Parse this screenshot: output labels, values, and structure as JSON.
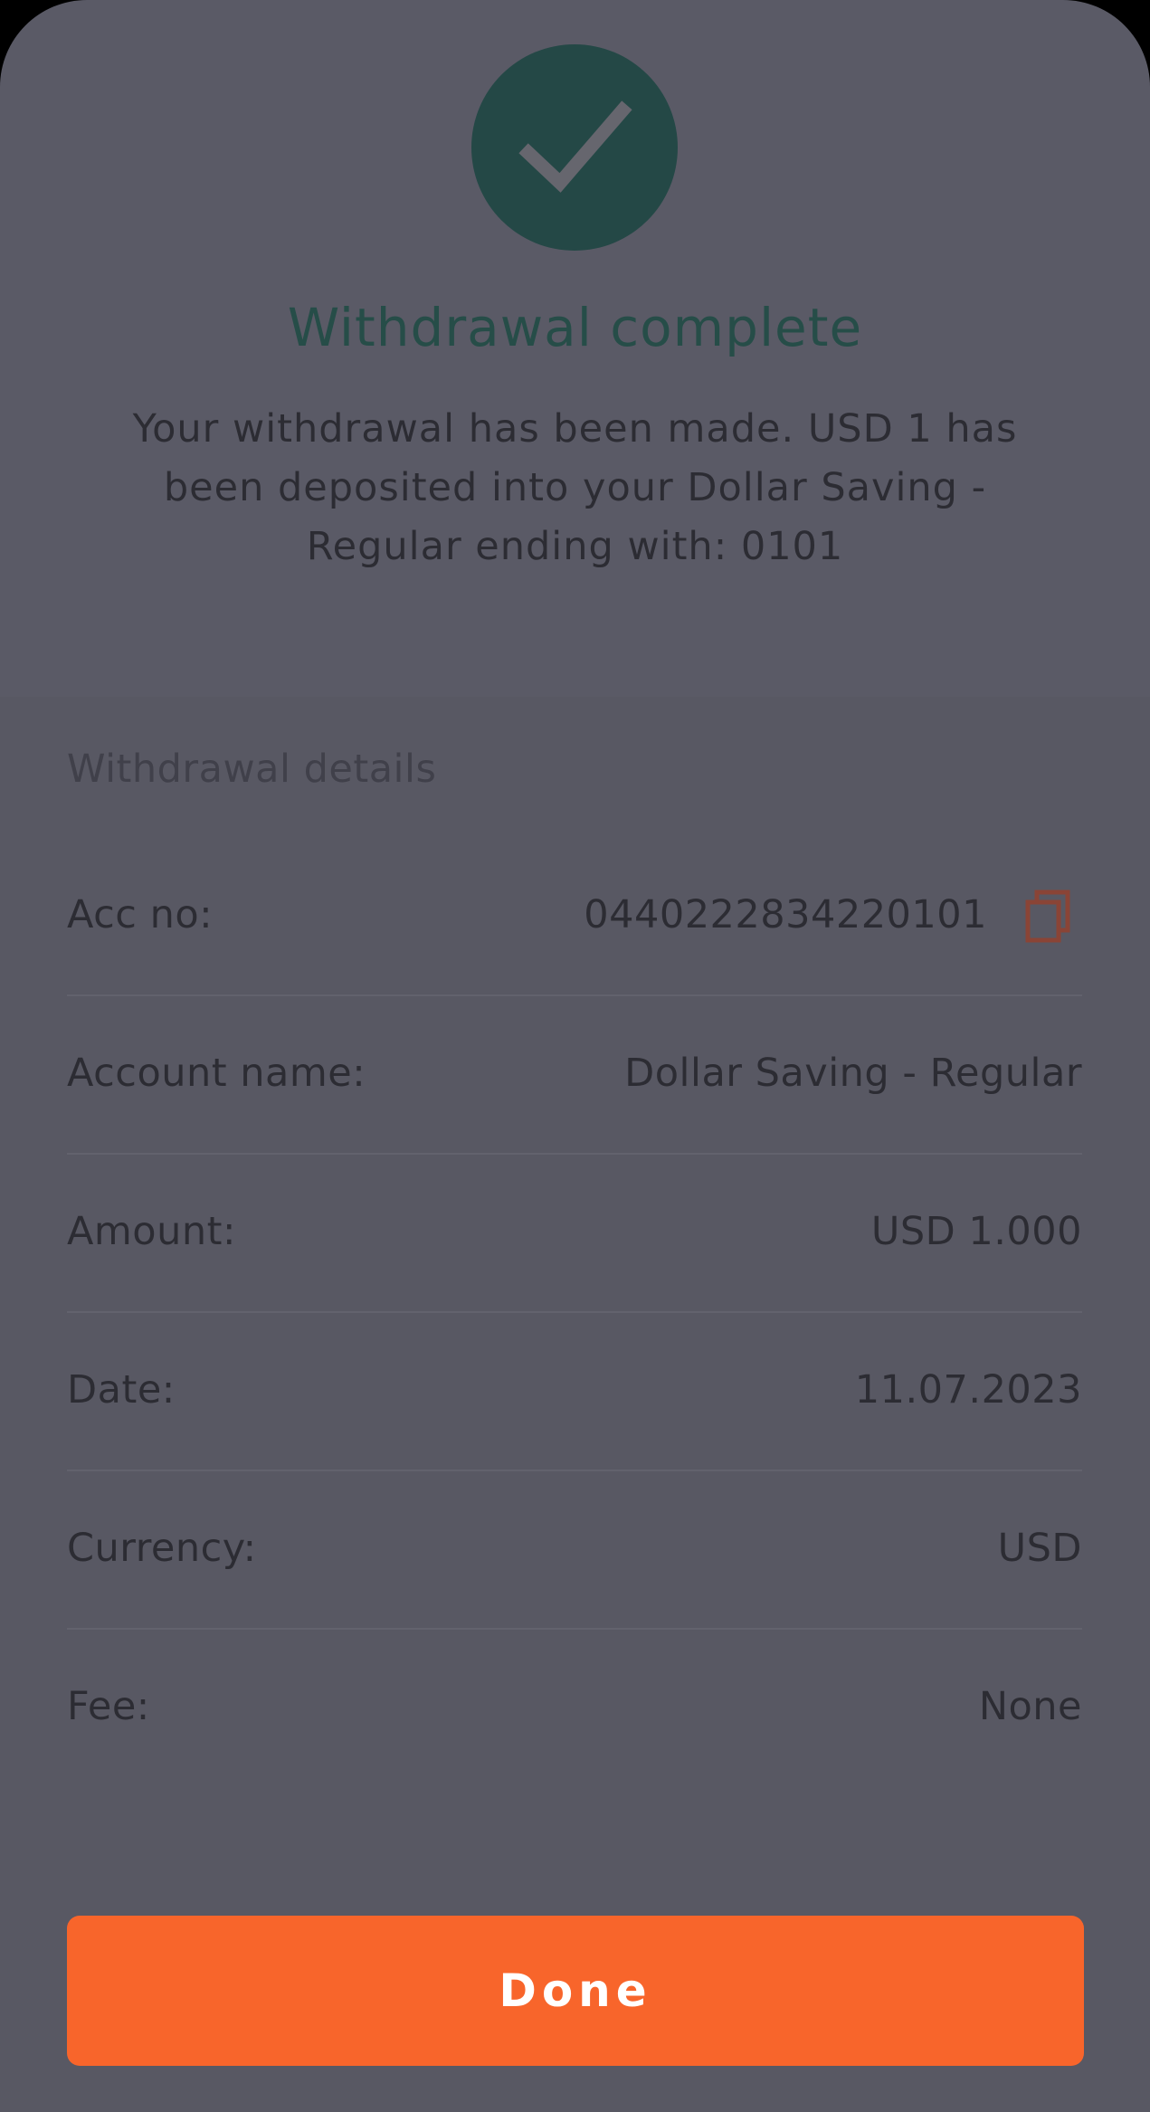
{
  "header": {
    "icon": "checkmark-icon",
    "title": "Withdrawal complete",
    "message": "Your withdrawal has been made. USD 1 has been deposited into your Dollar Saving - Regular ending with: 0101"
  },
  "details": {
    "heading": "Withdrawal details",
    "rows": [
      {
        "label": "Acc no:",
        "value": "0440222834220101",
        "icon": "copy-icon"
      },
      {
        "label": "Account name:",
        "value": "Dollar Saving - Regular"
      },
      {
        "label": "Amount:",
        "value": "USD 1.000"
      },
      {
        "label": "Date:",
        "value": "11.07.2023"
      },
      {
        "label": "Currency:",
        "value": "USD"
      },
      {
        "label": "Fee:",
        "value": "None"
      }
    ]
  },
  "actions": {
    "done_label": "Done"
  },
  "colors": {
    "background": "#5a5a66",
    "success_circle": "#244846",
    "title_text": "#264d48",
    "primary_button": "#f8652b",
    "copy_icon": "#8a4436"
  }
}
